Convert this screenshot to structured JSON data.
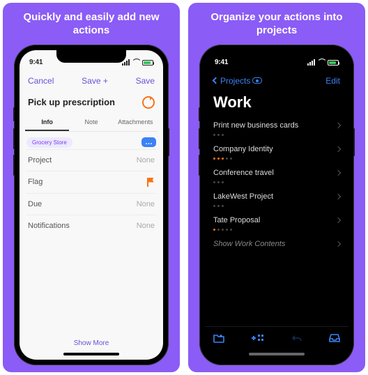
{
  "left": {
    "promo": "Quickly and easily add new actions",
    "status": {
      "time": "9:41"
    },
    "nav": {
      "cancel": "Cancel",
      "savePlus": "Save +",
      "save": "Save"
    },
    "title": "Pick up prescription",
    "tabs": {
      "info": "Info",
      "note": "Note",
      "attachments": "Attachments"
    },
    "tag": "Grocery Store",
    "moreTags": "…",
    "rows": {
      "project": {
        "label": "Project",
        "value": "None"
      },
      "flag": {
        "label": "Flag"
      },
      "due": {
        "label": "Due",
        "value": "None"
      },
      "notif": {
        "label": "Notifications",
        "value": "None"
      }
    },
    "showMore": "Show More"
  },
  "right": {
    "promo": "Organize your actions into projects",
    "status": {
      "time": "9:41"
    },
    "nav": {
      "back": "Projects",
      "edit": "Edit"
    },
    "title": "Work",
    "projects": [
      {
        "name": "Print new business cards"
      },
      {
        "name": "Company Identity"
      },
      {
        "name": "Conference travel"
      },
      {
        "name": "LakeWest Project"
      },
      {
        "name": "Tate Proposal"
      }
    ],
    "showContents": "Show Work Contents"
  }
}
